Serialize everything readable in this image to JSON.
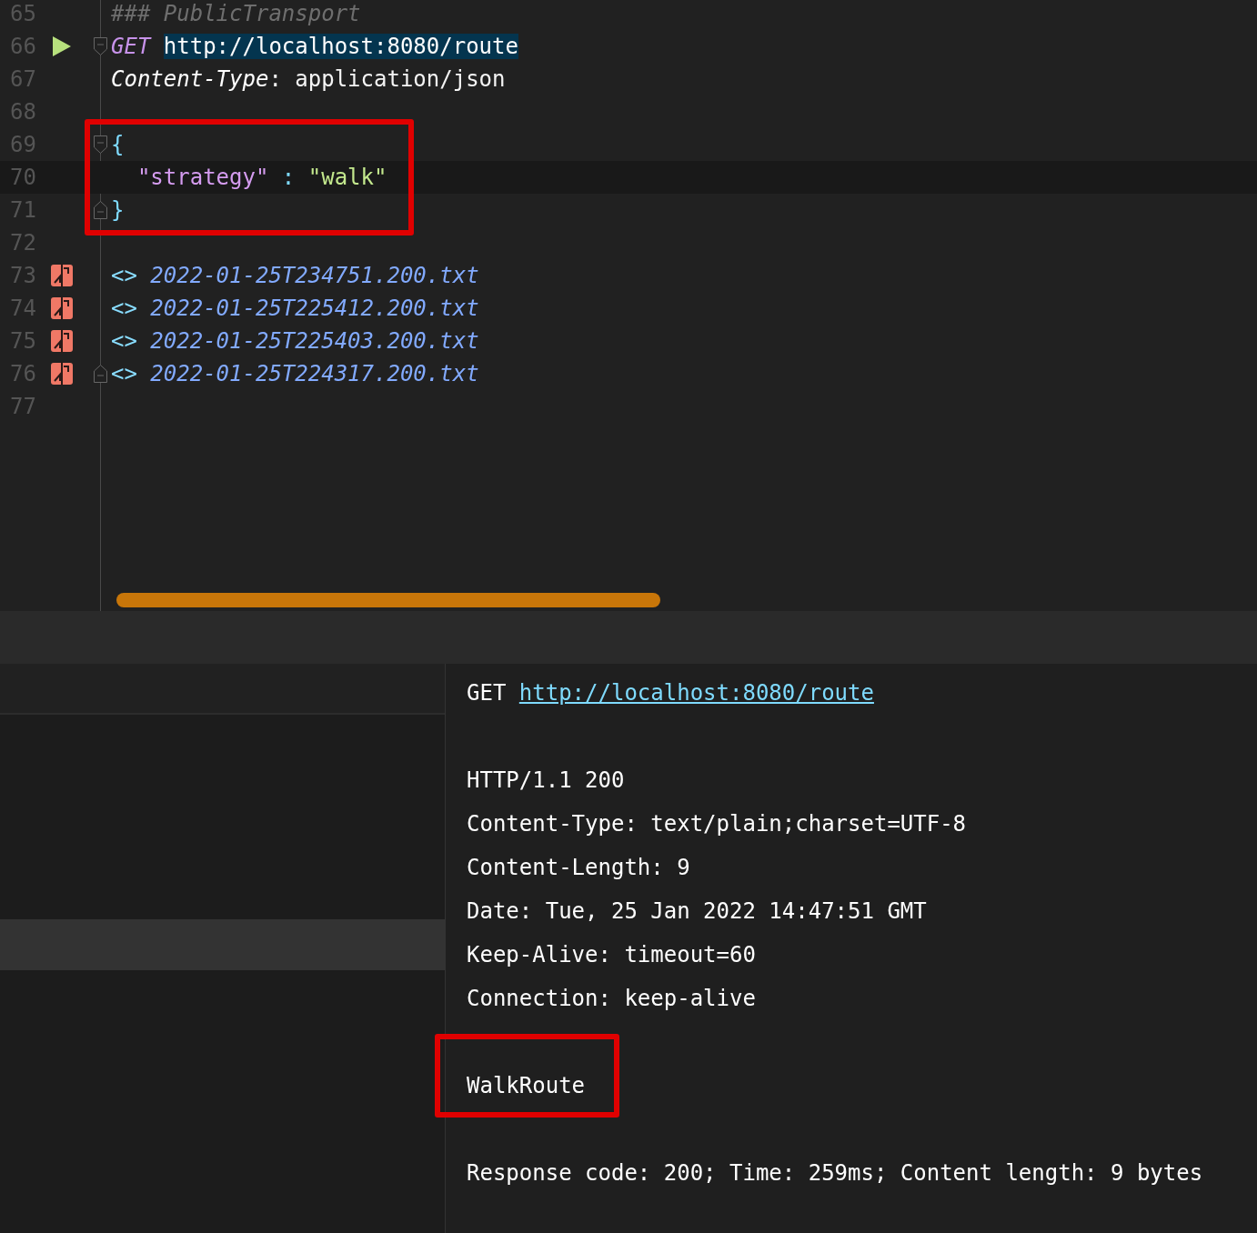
{
  "editor": {
    "lines": [
      {
        "number": "65",
        "current": false,
        "tokens": [
          {
            "kind": "comment",
            "text": "### PublicTransport"
          }
        ]
      },
      {
        "number": "66",
        "gutter_icon": {
          "kind": "run"
        },
        "fold": {
          "kind": "start"
        },
        "current": false,
        "tokens": [
          {
            "kind": "method",
            "text": "GET "
          },
          {
            "kind": "selected",
            "text": "http://localhost:8080/route"
          }
        ]
      },
      {
        "number": "67",
        "current": false,
        "tokens": [
          {
            "kind": "header",
            "text": "Content-Type"
          },
          {
            "kind": "plain",
            "text": ": application/json"
          }
        ]
      },
      {
        "number": "68",
        "current": false
      },
      {
        "number": "69",
        "fold": {
          "kind": "start"
        },
        "current": false,
        "tokens": [
          {
            "kind": "brace",
            "text": "{"
          }
        ]
      },
      {
        "number": "70",
        "current": true,
        "tokens": [
          {
            "kind": "key",
            "text": "  \"strategy\" "
          },
          {
            "kind": "brace",
            "text": ": "
          },
          {
            "kind": "string",
            "text": "\"walk\""
          }
        ]
      },
      {
        "number": "71",
        "fold": {
          "kind": "end"
        },
        "current": false,
        "tokens": [
          {
            "kind": "brace",
            "text": "}"
          }
        ]
      },
      {
        "number": "72",
        "current": false
      },
      {
        "number": "73",
        "gutter_icon": {
          "kind": "diff"
        },
        "current": false,
        "tokens": [
          {
            "kind": "arrow",
            "text": "<> "
          },
          {
            "kind": "file",
            "text": "2022-01-25T234751.200.txt"
          }
        ]
      },
      {
        "number": "74",
        "gutter_icon": {
          "kind": "diff"
        },
        "current": false,
        "tokens": [
          {
            "kind": "arrow",
            "text": "<> "
          },
          {
            "kind": "file",
            "text": "2022-01-25T225412.200.txt"
          }
        ]
      },
      {
        "number": "75",
        "gutter_icon": {
          "kind": "diff"
        },
        "current": false,
        "tokens": [
          {
            "kind": "arrow",
            "text": "<> "
          },
          {
            "kind": "file",
            "text": "2022-01-25T225403.200.txt"
          }
        ]
      },
      {
        "number": "76",
        "gutter_icon": {
          "kind": "diff"
        },
        "fold": {
          "kind": "end"
        },
        "current": false,
        "tokens": [
          {
            "kind": "arrow",
            "text": "<> "
          },
          {
            "kind": "file",
            "text": "2022-01-25T224317.200.txt"
          }
        ]
      },
      {
        "number": "77",
        "current": false
      }
    ]
  },
  "response": {
    "request_method": "GET",
    "request_url": "http://localhost:8080/route",
    "status_line": "HTTP/1.1 200",
    "headers": [
      "Content-Type: text/plain;charset=UTF-8",
      "Content-Length: 9",
      "Date: Tue, 25 Jan 2022 14:47:51 GMT",
      "Keep-Alive: timeout=60",
      "Connection: keep-alive"
    ],
    "body": "WalkRoute",
    "summary": "Response code: 200; Time: 259ms; Content length: 9 bytes"
  }
}
